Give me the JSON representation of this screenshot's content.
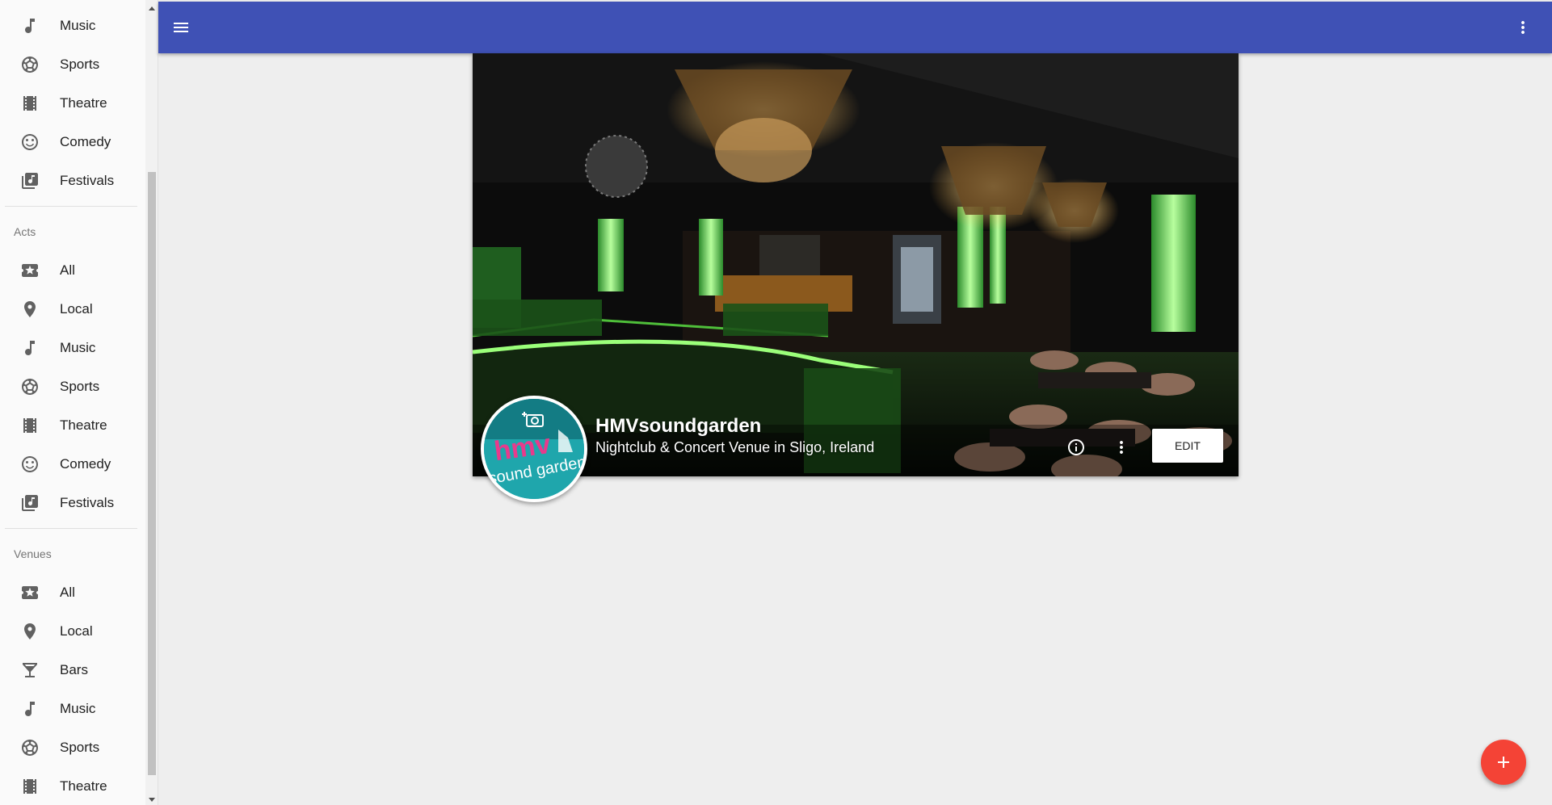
{
  "sidebar": {
    "top_items": [
      {
        "label": "Music",
        "icon": "music-note-icon"
      },
      {
        "label": "Sports",
        "icon": "soccer-ball-icon"
      },
      {
        "label": "Theatre",
        "icon": "film-icon"
      },
      {
        "label": "Comedy",
        "icon": "smiley-icon"
      },
      {
        "label": "Festivals",
        "icon": "library-music-icon"
      }
    ],
    "acts": {
      "header": "Acts",
      "items": [
        {
          "label": "All",
          "icon": "local-activity-icon"
        },
        {
          "label": "Local",
          "icon": "location-pin-icon"
        },
        {
          "label": "Music",
          "icon": "music-note-icon"
        },
        {
          "label": "Sports",
          "icon": "soccer-ball-icon"
        },
        {
          "label": "Theatre",
          "icon": "film-icon"
        },
        {
          "label": "Comedy",
          "icon": "smiley-icon"
        },
        {
          "label": "Festivals",
          "icon": "library-music-icon"
        }
      ]
    },
    "venues": {
      "header": "Venues",
      "items": [
        {
          "label": "All",
          "icon": "local-activity-icon"
        },
        {
          "label": "Local",
          "icon": "location-pin-icon"
        },
        {
          "label": "Bars",
          "icon": "cocktail-glass-icon"
        },
        {
          "label": "Music",
          "icon": "music-note-icon"
        },
        {
          "label": "Sports",
          "icon": "soccer-ball-icon"
        },
        {
          "label": "Theatre",
          "icon": "film-icon"
        }
      ]
    }
  },
  "appbar": {
    "color": "#3f51b5",
    "menu_icon": "hamburger-menu-icon",
    "more_icon": "more-vert-icon"
  },
  "venue": {
    "name": "HMVsoundgarden",
    "description": "Nightclub & Concert Venue in Sligo, Ireland",
    "logo_text_1": "hmv",
    "logo_text_2": "sound garden",
    "edit_label": "EDIT",
    "info_icon": "info-icon",
    "more_icon": "more-vert-icon",
    "camera_icon": "camera-icon"
  },
  "fab": {
    "icon": "add-icon",
    "color": "#f44336"
  }
}
